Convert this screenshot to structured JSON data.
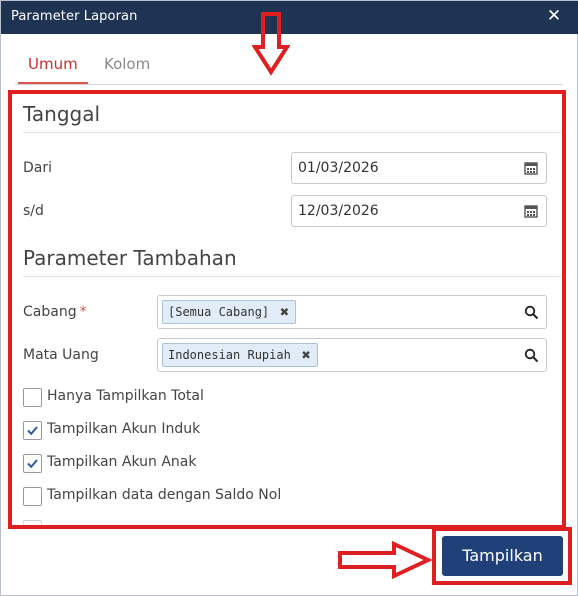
{
  "window": {
    "title": "Parameter Laporan",
    "close_glyph": "✕"
  },
  "tabs": [
    {
      "label": "Umum",
      "active": true
    },
    {
      "label": "Kolom",
      "active": false
    }
  ],
  "sections": {
    "date_section_title": "Tanggal",
    "extra_section_title": "Parameter Tambahan"
  },
  "dates": {
    "from_label": "Dari",
    "from_value": "01/03/2026",
    "to_label": "s/d",
    "to_value": "12/03/2026"
  },
  "branch": {
    "label": "Cabang",
    "required_mark": "*",
    "tag": "[Semua Cabang]",
    "remove_glyph": "✖"
  },
  "currency": {
    "label": "Mata Uang",
    "tag": "Indonesian Rupiah",
    "remove_glyph": "✖"
  },
  "options": [
    {
      "label": "Hanya Tampilkan Total",
      "checked": false
    },
    {
      "label": "Tampilkan Akun Induk",
      "checked": true
    },
    {
      "label": "Tampilkan Akun Anak",
      "checked": true
    },
    {
      "label": "Tampilkan data dengan Saldo Nol",
      "checked": false
    }
  ],
  "footer": {
    "primary_button": "Tampilkan"
  },
  "colors": {
    "titlebar": "#1f3352",
    "accent_tab": "#c9302c",
    "highlight": "#e02020",
    "primary_button": "#20407a",
    "tag_bg": "#e1ecf7"
  },
  "icons": {
    "date_picker": "calendar-icon",
    "lookup": "search-icon",
    "check": "check-icon",
    "annotation": "red-arrow-icon"
  }
}
